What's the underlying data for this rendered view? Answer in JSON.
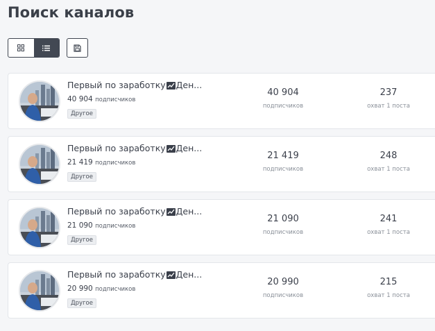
{
  "page": {
    "title": "Поиск каналов"
  },
  "toolbar": {
    "grid_icon": "grid-icon",
    "list_icon": "list-icon",
    "save_icon": "save-icon",
    "active_view": "list"
  },
  "colors": {
    "accent_dark": "#424853",
    "card_bg": "#ffffff",
    "page_bg": "#f5f6f8",
    "tag_bg": "#eceef1"
  },
  "channels": [
    {
      "name_before": "Первый по заработку",
      "name_after": "Ден...",
      "subs_value": "40 904",
      "subs_label": "подписчиков",
      "tag": "Другое",
      "stat_subs": "40 904",
      "stat_subs_label": "подписчиков",
      "reach": "237",
      "reach_label": "охват 1 поста"
    },
    {
      "name_before": "Первый по заработку",
      "name_after": "Ден...",
      "subs_value": "21 419",
      "subs_label": "подписчиков",
      "tag": "Другое",
      "stat_subs": "21 419",
      "stat_subs_label": "подписчиков",
      "reach": "248",
      "reach_label": "охват 1 поста"
    },
    {
      "name_before": "Первый по заработку",
      "name_after": "Ден...",
      "subs_value": "21 090",
      "subs_label": "подписчиков",
      "tag": "Другое",
      "stat_subs": "21 090",
      "stat_subs_label": "подписчиков",
      "reach": "241",
      "reach_label": "охват 1 поста"
    },
    {
      "name_before": "Первый по заработку",
      "name_after": "Ден...",
      "subs_value": "20 990",
      "subs_label": "подписчиков",
      "tag": "Другое",
      "stat_subs": "20 990",
      "stat_subs_label": "подписчиков",
      "reach": "215",
      "reach_label": "охват 1 поста"
    }
  ]
}
